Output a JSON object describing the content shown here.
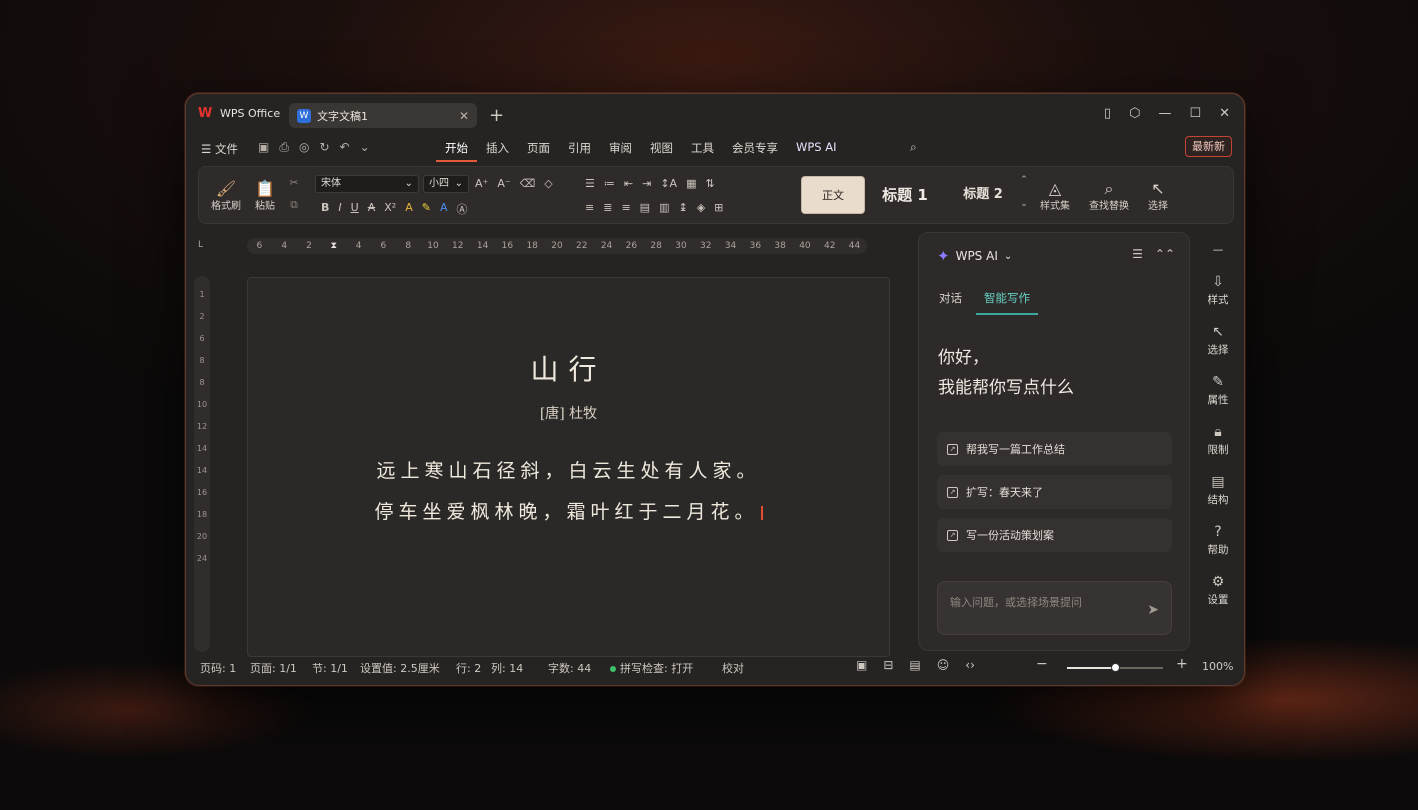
{
  "brand": {
    "name": "WPS Office"
  },
  "tab": {
    "title": "文字文稿1"
  },
  "menu": {
    "file": "文件",
    "tabs": [
      "开始",
      "插入",
      "页面",
      "引用",
      "审阅",
      "视图",
      "工具",
      "会员专享",
      "WPS AI"
    ],
    "update_label": "最新新"
  },
  "ribbon": {
    "format_painter": "格式刷",
    "paste": "粘贴",
    "font_name": "宋体",
    "font_size": "小四",
    "styles": {
      "normal": "正文",
      "h1": "标题 1",
      "h2": "标题 2"
    },
    "style_set": "样式集",
    "find_replace": "查找替换",
    "select": "选择"
  },
  "ruler": {
    "ticks": [
      "6",
      "4",
      "2",
      "",
      "4",
      "6",
      "8",
      "10",
      "12",
      "14",
      "16",
      "18",
      "20",
      "22",
      "24",
      "26",
      "28",
      "30",
      "32",
      "34",
      "36",
      "38",
      "40",
      "42",
      "44"
    ]
  },
  "vruler": {
    "ticks": [
      "1",
      "2",
      "6",
      "8",
      "8",
      "10",
      "12",
      "14",
      "14",
      "16",
      "18",
      "20",
      "24"
    ]
  },
  "document": {
    "title": "山行",
    "author": "[唐] 杜牧",
    "lines": [
      "远上寒山石径斜，白云生处有人家。",
      "停车坐爱枫林晚，霜叶红于二月花。"
    ]
  },
  "ai": {
    "title": "WPS AI",
    "tabs": [
      "对话",
      "智能写作"
    ],
    "greeting_1": "你好，",
    "greeting_2": "我能帮你写点什么",
    "suggestions": [
      "帮我写一篇工作总结",
      "扩写：春天来了",
      "写一份活动策划案"
    ],
    "input_placeholder": "输入问题，或选择场景提问"
  },
  "sidebar": [
    "样式",
    "选择",
    "属性",
    "限制",
    "结构",
    "帮助",
    "设置"
  ],
  "status": {
    "page": "页码: 1",
    "pages": "页面: 1/1",
    "section": "节: 1/1",
    "setting": "设置值: 2.5厘米",
    "row": "行: 2",
    "col": "列: 14",
    "words": "字数: 44",
    "spell": "拼写检查: 打开",
    "proof": "校对",
    "zoom": "100%",
    "zoom_level": 0.5
  },
  "colors": {
    "accent": "#e35a3b",
    "ai_accent": "#3aa89a",
    "doc_icon": "#2f6fd8"
  }
}
